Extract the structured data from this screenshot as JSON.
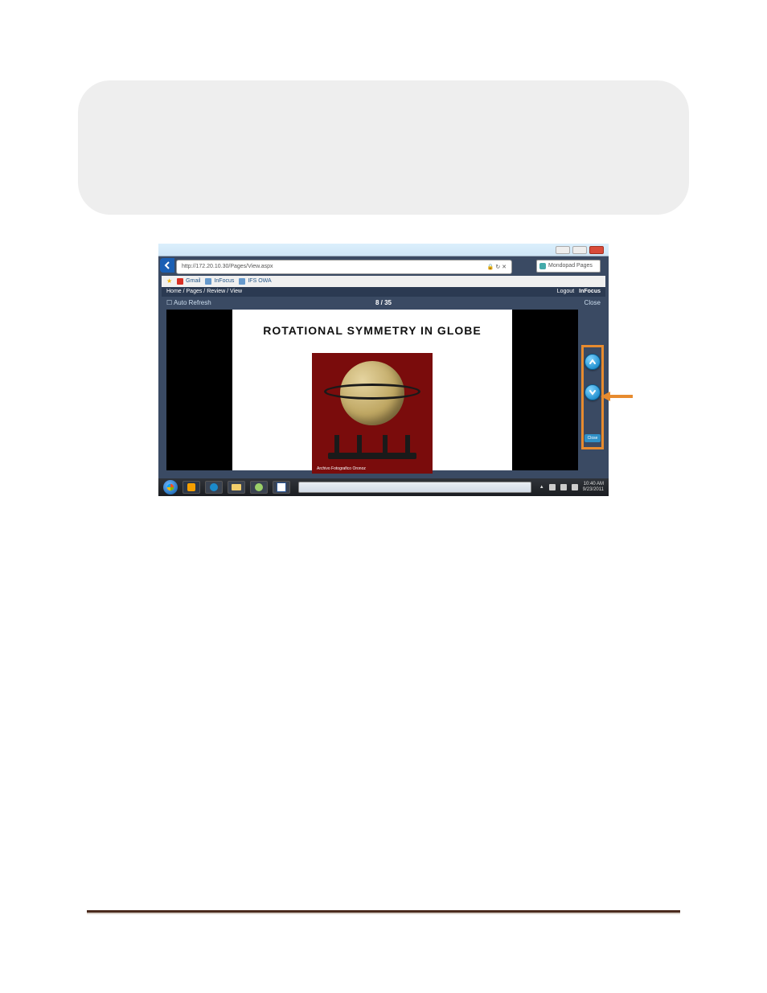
{
  "callout": {
    "items": [
      "",
      ""
    ]
  },
  "browser": {
    "url": "http://172.20.10.30/Pages/View.aspx",
    "tab_title": "Mondopad Pages",
    "toolbar": {
      "gmail": "Gmail",
      "infocus": "InFocus",
      "owa": "IFS OWA"
    }
  },
  "app": {
    "breadcrumb_left": "Home / Pages / Review / View",
    "logout": "Logout",
    "brand": "InFocus",
    "auto_refresh": "Auto Refresh",
    "close": "Close",
    "page_counter": "8 / 35",
    "slide_title": "ROTATIONAL SYMMETRY IN GLOBE",
    "image_caption": "Archivo Fotografico Oronoz",
    "rail": {
      "up": "▲",
      "down": "▼",
      "close": "Close"
    }
  },
  "taskbar": {
    "time": "10:40 AM",
    "date": "9/23/2011"
  }
}
